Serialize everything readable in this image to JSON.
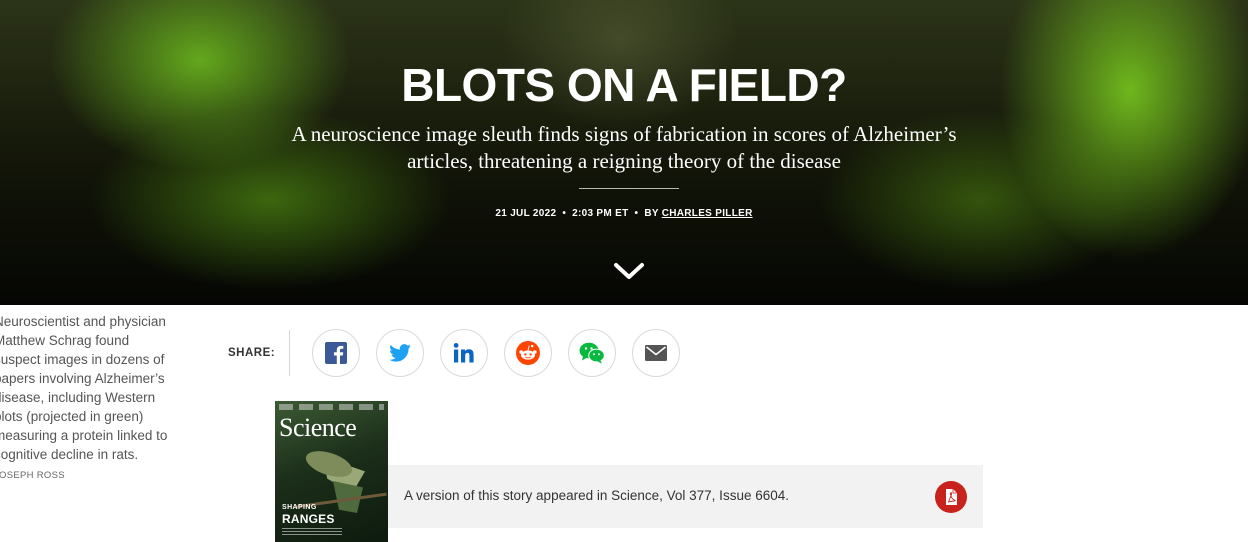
{
  "hero": {
    "title": "BLOTS ON A FIELD?",
    "dek": "A neuroscience image sleuth finds signs of fabrication in scores of Alzheimer’s articles, threatening a reigning theory of the disease",
    "date": "21 JUL 2022",
    "time": "2:03 PM ET",
    "by_label": "BY",
    "author": "CHARLES PILLER",
    "scroll_icon": "chevron-down-icon"
  },
  "caption": {
    "lines": [
      "Neuroscientist and physician",
      "Matthew Schrag found",
      "suspect images in dozens of",
      "papers involving Alzheimer’s",
      "disease, including Western",
      "blots (projected in green)",
      "measuring a protein linked to",
      "cognitive decline in rats."
    ],
    "credit": "JOSEPH ROSS"
  },
  "share": {
    "label": "SHARE:",
    "buttons": [
      {
        "icon": "facebook-icon",
        "color": "#3b5998"
      },
      {
        "icon": "twitter-icon",
        "color": "#1da1f2"
      },
      {
        "icon": "linkedin-icon",
        "color": "#0a66c2"
      },
      {
        "icon": "reddit-icon",
        "color": "#ff4500"
      },
      {
        "icon": "wechat-icon",
        "color": "#09b83e"
      },
      {
        "icon": "email-icon",
        "color": "#555555"
      }
    ]
  },
  "cover": {
    "masthead": "Science",
    "sub": "SHAPING",
    "headline": "RANGES"
  },
  "version": {
    "text": "A version of this story appeared in Science, Vol 377, Issue 6604.",
    "pdf_icon": "pdf-icon",
    "pdf_color": "#c7221b"
  }
}
